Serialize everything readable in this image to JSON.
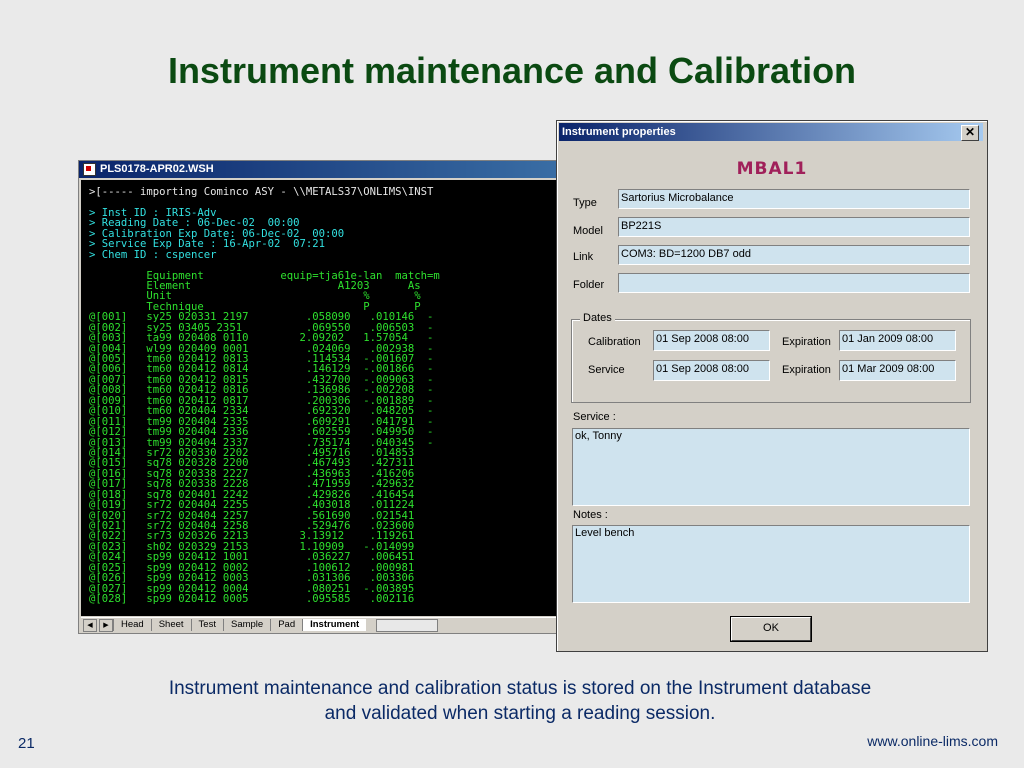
{
  "slide": {
    "title": "Instrument maintenance and Calibration",
    "caption_line1": "Instrument maintenance and calibration status is stored on the Instrument database",
    "caption_line2": "and validated when starting a reading session.",
    "page_number": "21",
    "website": "www.online-lims.com"
  },
  "terminal": {
    "title": "PLS0178-APR02.WSH",
    "lines": [
      {
        "text": ">[----- importing Cominco ASY - \\\\METALS37\\ONLIMS\\INST",
        "color": "white"
      },
      {
        "text": "",
        "color": "white"
      },
      {
        "text": "> Inst ID : IRIS-Adv",
        "color": "cyan"
      },
      {
        "text": "> Reading Date : 06-Dec-02  00:00",
        "color": "cyan"
      },
      {
        "text": "> Calibration Exp Date: 06-Dec-02  00:00",
        "color": "cyan"
      },
      {
        "text": "> Service Exp Date : 16-Apr-02  07:21",
        "color": "cyan"
      },
      {
        "text": "> Chem ID : cspencer",
        "color": "cyan"
      },
      {
        "text": "",
        "color": "white"
      },
      {
        "text": "         Equipment            equip=tja61e-lan  match=m",
        "color": "green"
      },
      {
        "text": "         Element                       A1203      As",
        "color": "green"
      },
      {
        "text": "         Unit                              %       %",
        "color": "green"
      },
      {
        "text": "         Technique                         P       P",
        "color": "green"
      },
      {
        "text": "@[001]   sy25 020331 2197         .058090   .010146  -",
        "color": "green"
      },
      {
        "text": "@[002]   sy25 03405 2351          .069550   .006503  -",
        "color": "green"
      },
      {
        "text": "@[003]   ta99 020408 0110        2.09202   1.57054   -",
        "color": "green"
      },
      {
        "text": "@[004]   wl99 020409 0001         .024069   .002938  -",
        "color": "green"
      },
      {
        "text": "@[005]   tm60 020412 0813         .114534  -.001607  -",
        "color": "green"
      },
      {
        "text": "@[006]   tm60 020412 0814         .146129  -.001866  -",
        "color": "green"
      },
      {
        "text": "@[007]   tm60 020412 0815         .432700  -.009063  -",
        "color": "green"
      },
      {
        "text": "@[008]   tm60 020412 0816         .136986  -.002208  -",
        "color": "green"
      },
      {
        "text": "@[009]   tm60 020412 0817         .200306  -.001889  -",
        "color": "green"
      },
      {
        "text": "@[010]   tm60 020404 2334         .692320   .048205  -",
        "color": "green"
      },
      {
        "text": "@[011]   tm99 020404 2335         .609291   .041791  -",
        "color": "green"
      },
      {
        "text": "@[012]   tm99 020404 2336         .602559   .049950  -",
        "color": "green"
      },
      {
        "text": "@[013]   tm99 020404 2337         .735174   .040345  -",
        "color": "green"
      },
      {
        "text": "@[014]   sr72 020330 2202         .495716   .014853",
        "color": "green"
      },
      {
        "text": "@[015]   sq78 020328 2200         .467493   .427311",
        "color": "green"
      },
      {
        "text": "@[016]   sq78 020338 2227         .436963   .416206",
        "color": "green"
      },
      {
        "text": "@[017]   sq78 020338 2228         .471959   .429632",
        "color": "green"
      },
      {
        "text": "@[018]   sq78 020401 2242         .429826   .416454",
        "color": "green"
      },
      {
        "text": "@[019]   sr72 020404 2255         .403018   .011224",
        "color": "green"
      },
      {
        "text": "@[020]   sr72 020404 2257         .561690   .021541",
        "color": "green"
      },
      {
        "text": "@[021]   sr72 020404 2258         .529476   .023600",
        "color": "green"
      },
      {
        "text": "@[022]   sr73 020326 2213        3.13912    .119261",
        "color": "green"
      },
      {
        "text": "@[023]   sh02 020329 2153        1.10909   -.014099",
        "color": "green"
      },
      {
        "text": "@[024]   sp99 020412 1001         .036227   .006451",
        "color": "green"
      },
      {
        "text": "@[025]   sp99 020412 0002         .100612   .000981",
        "color": "green"
      },
      {
        "text": "@[026]   sp99 020412 0003         .031306   .003306",
        "color": "green"
      },
      {
        "text": "@[027]   sp99 020412 0004         .080251  -.003895",
        "color": "green"
      },
      {
        "text": "@[028]   sp99 020412 0005         .095585   .002116",
        "color": "green"
      }
    ],
    "tabs": [
      "Head",
      "Sheet",
      "Test",
      "Sample",
      "Pad",
      "Instrument"
    ],
    "active_tab": "Instrument"
  },
  "dialog": {
    "title": "Instrument properties",
    "close_glyph": "✕",
    "heading": "MBAL1",
    "type_label": "Type",
    "type_value": "Sartorius Microbalance",
    "model_label": "Model",
    "model_value": "BP221S",
    "link_label": "Link",
    "link_value": "COM3: BD=1200 DB7 odd",
    "folder_label": "Folder",
    "folder_value": "",
    "dates_legend": "Dates",
    "calibration_label": "Calibration",
    "calibration_value": "01 Sep 2008  08:00",
    "calibration_exp_label": "Expiration",
    "calibration_exp_value": "01 Jan 2009  08:00",
    "service_label": "Service",
    "service_value": "01 Sep 2008  08:00",
    "service_exp_label": "Expiration",
    "service_exp_value": "01 Mar 2009  08:00",
    "service_notes_label": "Service :",
    "service_notes_value": "ok, Tonny",
    "notes_label": "Notes :",
    "notes_value": "Level bench",
    "ok_label": "OK"
  }
}
